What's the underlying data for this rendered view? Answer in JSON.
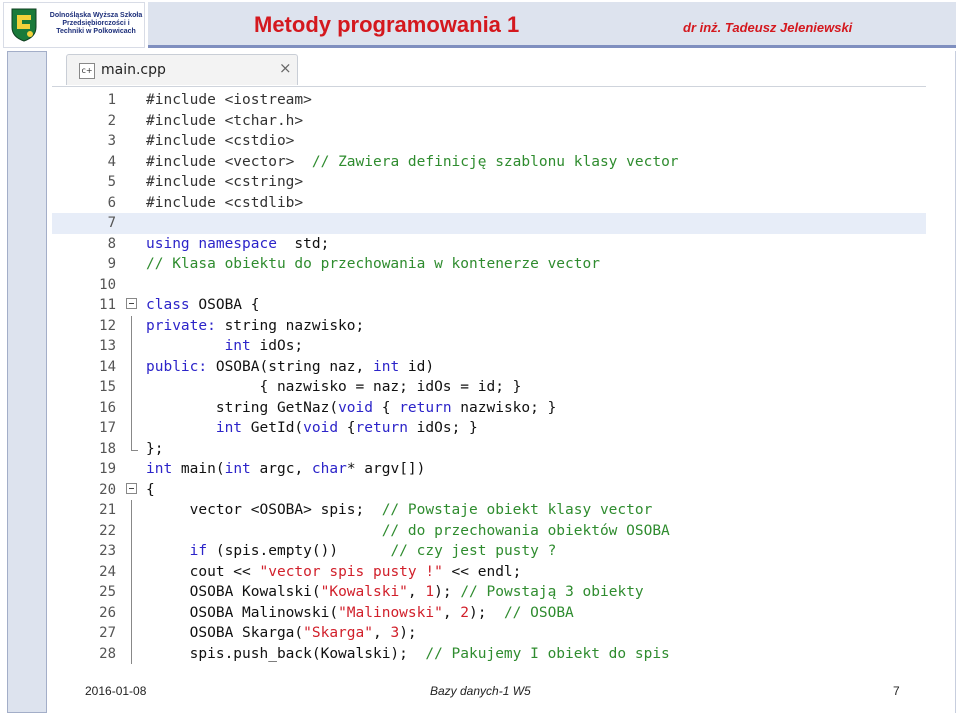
{
  "header": {
    "logo_text": "Dolnośląska Wyższa Szkoła Przedsiębiorczości i Techniki w Polkowicach",
    "title": "Metody programowania   1",
    "author": "dr inż. Tadeusz Jeleniewski"
  },
  "editor": {
    "tab_icon": "c+",
    "tab_label": "main.cpp",
    "tab_close": "×"
  },
  "code_lines": [
    {
      "n": "1",
      "fold": "",
      "hl": false,
      "tokens": [
        [
          "pp",
          "#include <iostream>"
        ]
      ]
    },
    {
      "n": "2",
      "fold": "",
      "hl": false,
      "tokens": [
        [
          "pp",
          "#include <tchar.h>"
        ]
      ]
    },
    {
      "n": "3",
      "fold": "",
      "hl": false,
      "tokens": [
        [
          "pp",
          "#include <cstdio>"
        ]
      ]
    },
    {
      "n": "4",
      "fold": "",
      "hl": false,
      "tokens": [
        [
          "pp",
          "#include <vector>  "
        ],
        [
          "cm",
          "// Zawiera definicję szablonu klasy vector"
        ]
      ]
    },
    {
      "n": "5",
      "fold": "",
      "hl": false,
      "tokens": [
        [
          "pp",
          "#include <cstring>"
        ]
      ]
    },
    {
      "n": "6",
      "fold": "",
      "hl": false,
      "tokens": [
        [
          "pp",
          "#include <cstdlib>"
        ]
      ]
    },
    {
      "n": "7",
      "fold": "",
      "hl": true,
      "tokens": []
    },
    {
      "n": "8",
      "fold": "",
      "hl": false,
      "tokens": [
        [
          "kw",
          "using namespace"
        ],
        [
          "",
          "  std;"
        ]
      ]
    },
    {
      "n": "9",
      "fold": "",
      "hl": false,
      "tokens": [
        [
          "cm",
          "// Klasa obiektu do przechowania w kontenerze vector"
        ]
      ]
    },
    {
      "n": "10",
      "fold": "",
      "hl": false,
      "tokens": []
    },
    {
      "n": "11",
      "fold": "box",
      "hl": false,
      "tokens": [
        [
          "kw",
          "class"
        ],
        [
          "",
          " OSOBA {"
        ]
      ]
    },
    {
      "n": "12",
      "fold": "bar",
      "hl": false,
      "tokens": [
        [
          "kw",
          "private:"
        ],
        [
          "",
          " string nazwisko;"
        ]
      ]
    },
    {
      "n": "13",
      "fold": "bar",
      "hl": false,
      "tokens": [
        [
          "",
          "         "
        ],
        [
          "kw",
          "int"
        ],
        [
          "",
          " idOs;"
        ]
      ]
    },
    {
      "n": "14",
      "fold": "bar",
      "hl": false,
      "tokens": [
        [
          "kw",
          "public:"
        ],
        [
          "",
          " OSOBA(string naz, "
        ],
        [
          "kw",
          "int"
        ],
        [
          "",
          " id)"
        ]
      ]
    },
    {
      "n": "15",
      "fold": "bar",
      "hl": false,
      "tokens": [
        [
          "",
          "             { nazwisko = naz; idOs = id; }"
        ]
      ]
    },
    {
      "n": "16",
      "fold": "bar",
      "hl": false,
      "tokens": [
        [
          "",
          "        string GetNaz("
        ],
        [
          "kw",
          "void"
        ],
        [
          "",
          " { "
        ],
        [
          "kw",
          "return"
        ],
        [
          "",
          " nazwisko; }"
        ]
      ]
    },
    {
      "n": "17",
      "fold": "bar",
      "hl": false,
      "tokens": [
        [
          "",
          "        "
        ],
        [
          "kw",
          "int"
        ],
        [
          "",
          " GetId("
        ],
        [
          "kw",
          "void"
        ],
        [
          "",
          " {"
        ],
        [
          "kw",
          "return"
        ],
        [
          "",
          " idOs; }"
        ]
      ]
    },
    {
      "n": "18",
      "fold": "end",
      "hl": false,
      "tokens": [
        [
          "",
          "};"
        ]
      ]
    },
    {
      "n": "19",
      "fold": "",
      "hl": false,
      "tokens": [
        [
          "kw",
          "int"
        ],
        [
          "",
          " main("
        ],
        [
          "kw",
          "int"
        ],
        [
          "",
          " argc, "
        ],
        [
          "kw",
          "char"
        ],
        [
          "",
          "* argv[])"
        ]
      ]
    },
    {
      "n": "20",
      "fold": "box",
      "hl": false,
      "tokens": [
        [
          "",
          "{"
        ]
      ]
    },
    {
      "n": "21",
      "fold": "bar",
      "hl": false,
      "tokens": [
        [
          "",
          "     vector <OSOBA> spis;  "
        ],
        [
          "cm",
          "// Powstaje obiekt klasy vector"
        ]
      ]
    },
    {
      "n": "22",
      "fold": "bar",
      "hl": false,
      "tokens": [
        [
          "",
          "                           "
        ],
        [
          "cm",
          "// do przechowania obiektów OSOBA"
        ]
      ]
    },
    {
      "n": "23",
      "fold": "bar",
      "hl": false,
      "tokens": [
        [
          "",
          "     "
        ],
        [
          "kw",
          "if"
        ],
        [
          "",
          " (spis.empty())      "
        ],
        [
          "cm",
          "// czy jest pusty ?"
        ]
      ]
    },
    {
      "n": "24",
      "fold": "bar",
      "hl": false,
      "tokens": [
        [
          "",
          "     cout << "
        ],
        [
          "str",
          "\"vector spis pusty !\""
        ],
        [
          "",
          " << endl;"
        ]
      ]
    },
    {
      "n": "25",
      "fold": "bar",
      "hl": false,
      "tokens": [
        [
          "",
          "     OSOBA Kowalski("
        ],
        [
          "str",
          "\"Kowalski\""
        ],
        [
          "",
          ", "
        ],
        [
          "num",
          "1"
        ],
        [
          "",
          "); "
        ],
        [
          "cm",
          "// Powstają 3 obiekty"
        ]
      ]
    },
    {
      "n": "26",
      "fold": "bar",
      "hl": false,
      "tokens": [
        [
          "",
          "     OSOBA Malinowski("
        ],
        [
          "str",
          "\"Malinowski\""
        ],
        [
          "",
          ", "
        ],
        [
          "num",
          "2"
        ],
        [
          "",
          ");  "
        ],
        [
          "cm",
          "// OSOBA"
        ]
      ]
    },
    {
      "n": "27",
      "fold": "bar",
      "hl": false,
      "tokens": [
        [
          "",
          "     OSOBA Skarga("
        ],
        [
          "str",
          "\"Skarga\""
        ],
        [
          "",
          ", "
        ],
        [
          "num",
          "3"
        ],
        [
          "",
          ");"
        ]
      ]
    },
    {
      "n": "28",
      "fold": "bar",
      "hl": false,
      "tokens": [
        [
          "",
          "     spis.push_back(Kowalski);  "
        ],
        [
          "cm",
          "// Pakujemy I obiekt do spis"
        ]
      ]
    }
  ],
  "footer": {
    "date": "2016-01-08",
    "course": "Bazy danych-1 W5",
    "page": "7"
  }
}
